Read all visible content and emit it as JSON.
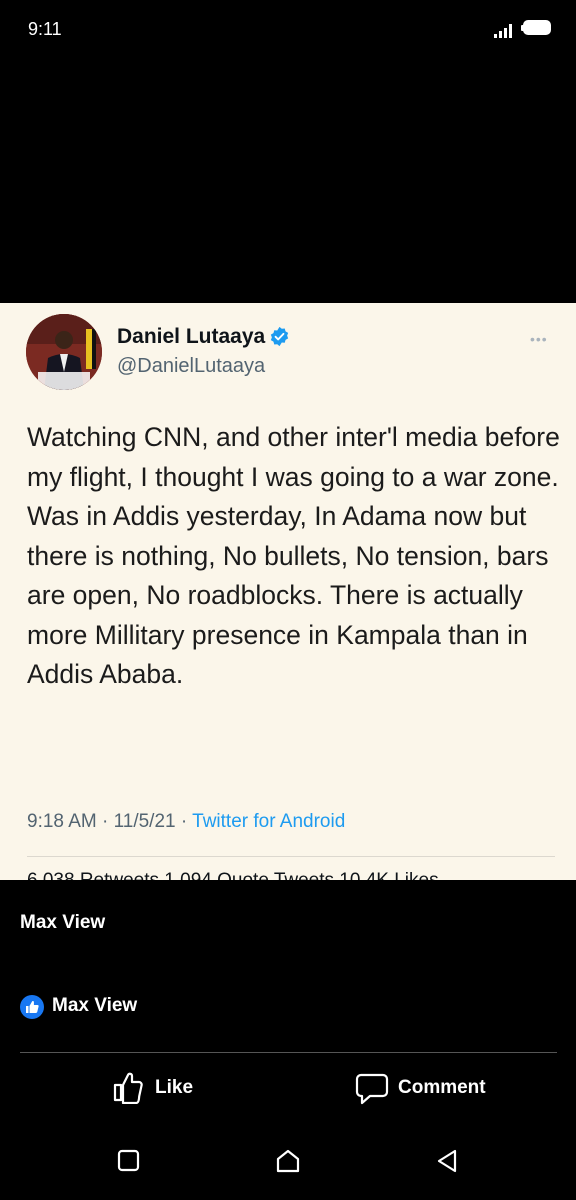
{
  "status_bar": {
    "time": "9:11"
  },
  "tweet": {
    "display_name": "Daniel Lutaaya",
    "handle": "@DanielLutaaya",
    "text": "Watching CNN, and other inter'l media before my flight, I thought I was going to a war zone.\nWas in Addis yesterday, In Adama now but there is nothing, No bullets, No tension, bars are open, No roadblocks. There is actually more Millitary presence in Kampala than in Addis Ababa.",
    "time": "9:18 AM",
    "date": "11/5/21",
    "separator": " · ",
    "source": "Twitter for Android",
    "stats_partial": "6,038 Retweets  1,094 Quote Tweets  10.4K Likes"
  },
  "post": {
    "caption": "Max View",
    "reaction_name": "Max View"
  },
  "actions": {
    "like": "Like",
    "comment": "Comment"
  },
  "colors": {
    "facebook_blue": "#1877f2",
    "twitter_blue": "#1d9bf0",
    "tweet_background": "#fbf6ea"
  },
  "icons": [
    "signal-icon",
    "battery-icon",
    "verified-icon",
    "more-icon",
    "like-badge-icon",
    "like-icon",
    "comment-icon",
    "recents-icon",
    "home-icon",
    "back-icon"
  ]
}
